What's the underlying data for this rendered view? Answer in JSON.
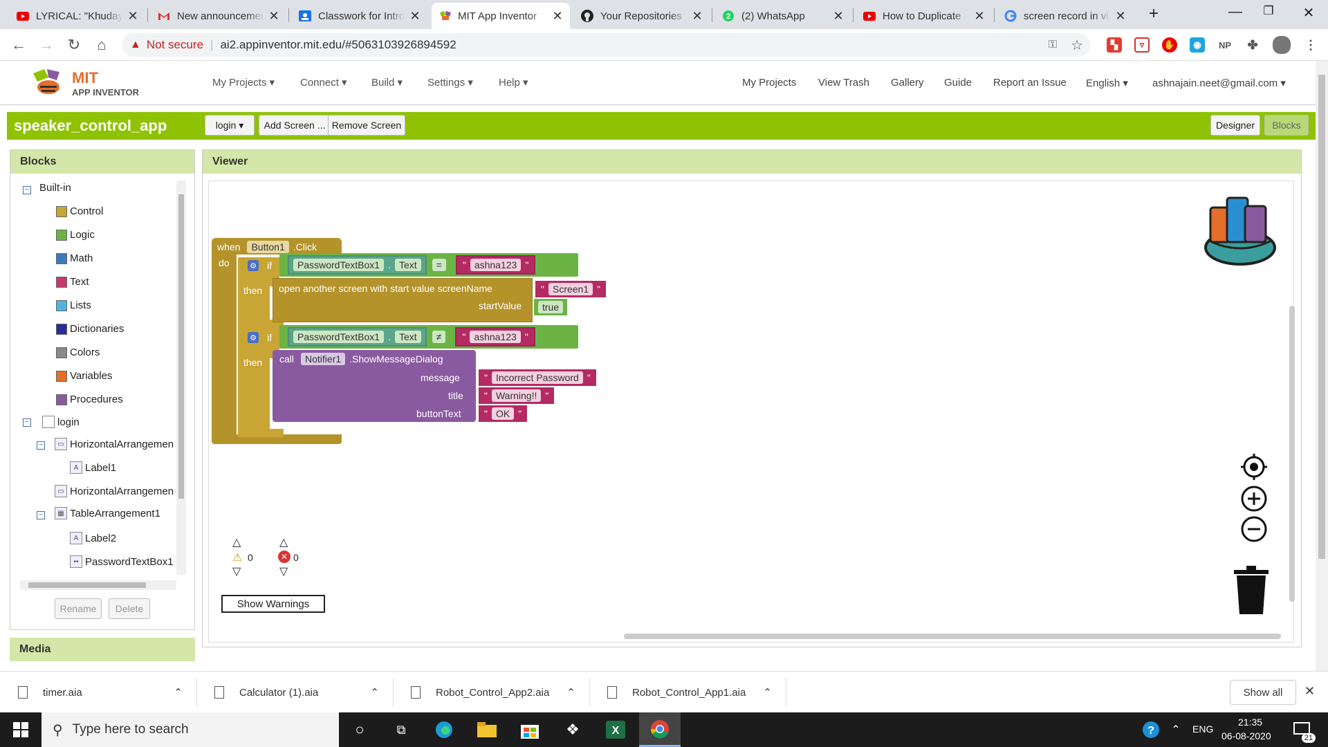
{
  "browser": {
    "tabs": [
      {
        "title": "LYRICAL: \"Khudaya",
        "icon": "youtube-icon",
        "color": "#e00"
      },
      {
        "title": "New announcement",
        "icon": "gmail-icon",
        "color": "#d33"
      },
      {
        "title": "Classwork for Intro",
        "icon": "classroom-icon",
        "color": "#1a73e8"
      },
      {
        "title": "MIT App Inventor",
        "icon": "appinventor-icon",
        "color": "#8a5aa0"
      },
      {
        "title": "Your Repositories",
        "icon": "github-icon",
        "color": "#222"
      },
      {
        "title": "(2) WhatsApp",
        "icon": "whatsapp-icon",
        "color": "#25d366"
      },
      {
        "title": "How to Duplicate",
        "icon": "youtube-icon",
        "color": "#e00"
      },
      {
        "title": "screen record in vi",
        "icon": "google-icon",
        "color": "#4285f4"
      }
    ],
    "new_tab": "+",
    "security_label": "Not secure",
    "url": "ai2.appinventor.mit.edu/#5063103926894592",
    "ext_np": "NP"
  },
  "app": {
    "logo_line1": "MIT",
    "logo_line2": "APP INVENTOR",
    "menus": [
      "My Projects ▾",
      "Connect ▾",
      "Build ▾",
      "Settings ▾",
      "Help ▾"
    ],
    "right_links": [
      "My Projects",
      "View Trash",
      "Gallery",
      "Guide",
      "Report an Issue",
      "English ▾",
      "ashnajain.neet@gmail.com ▾"
    ],
    "project_name": "speaker_control_app",
    "screen_select": "login ▾",
    "add_screen": "Add Screen ...",
    "remove_screen": "Remove Screen",
    "designer": "Designer",
    "blocks": "Blocks"
  },
  "blocks_panel": {
    "title": "Blocks",
    "builtin": "Built-in",
    "builtin_items": [
      {
        "label": "Control",
        "color": "#c8a534"
      },
      {
        "label": "Logic",
        "color": "#6bb444"
      },
      {
        "label": "Math",
        "color": "#3c7abf"
      },
      {
        "label": "Text",
        "color": "#c43a6c"
      },
      {
        "label": "Lists",
        "color": "#4fb4e0"
      },
      {
        "label": "Dictionaries",
        "color": "#2b2b9a"
      },
      {
        "label": "Colors",
        "color": "#888888"
      },
      {
        "label": "Variables",
        "color": "#e46e2c"
      },
      {
        "label": "Procedures",
        "color": "#8a5aa0"
      }
    ],
    "screen": "login",
    "components": [
      "HorizontalArrangemen",
      "Label1",
      "HorizontalArrangemen",
      "TableArrangement1",
      "Label2",
      "PasswordTextBox1"
    ],
    "rename": "Rename",
    "delete": "Delete",
    "media": "Media"
  },
  "viewer": {
    "title": "Viewer",
    "event": {
      "when": "when",
      "component": "Button1",
      "event": ".Click",
      "do": "do"
    },
    "if1": {
      "if": "if",
      "then": "then",
      "comp": "PasswordTextBox1",
      "prop": "Text",
      "op": "=",
      "text": "ashna123",
      "open": "open another screen with start value  screenName",
      "screen": "Screen1",
      "startValue": "startValue",
      "bool": "true"
    },
    "if2": {
      "if": "if",
      "then": "then",
      "comp": "PasswordTextBox1",
      "prop": "Text",
      "op": "≠",
      "text": "ashna123",
      "call": "call",
      "notifier": "Notifier1",
      "method": ".ShowMessageDialog",
      "message_label": "message",
      "message": "Incorrect Password",
      "title_label": "title",
      "title": "Warning!!",
      "button_label": "buttonText",
      "button": "OK"
    },
    "warnings_count": "0",
    "errors_count": "0",
    "show_warnings": "Show Warnings"
  },
  "downloads": {
    "files": [
      "timer.aia",
      "Calculator (1).aia",
      "Robot_Control_App2.aia",
      "Robot_Control_App1.aia"
    ],
    "show_all": "Show all"
  },
  "taskbar": {
    "search": "Type here to search",
    "lang": "ENG",
    "time": "21:35",
    "date": "06-08-2020",
    "notif_count": "21"
  }
}
